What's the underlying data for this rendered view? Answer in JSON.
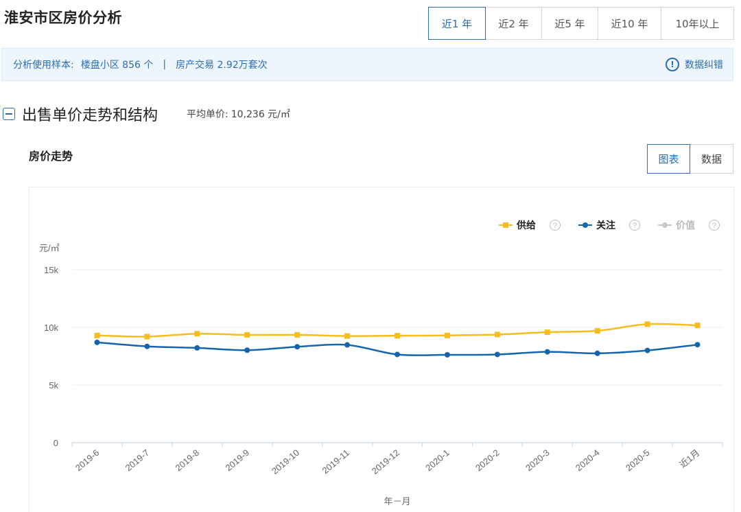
{
  "header": {
    "title": "淮安市区房价分析"
  },
  "range_tabs": [
    {
      "label": "近1 年",
      "active": true
    },
    {
      "label": "近2 年",
      "active": false
    },
    {
      "label": "近5 年",
      "active": false
    },
    {
      "label": "近10 年",
      "active": false
    },
    {
      "label": "10年以上",
      "active": false
    }
  ],
  "info_bar": {
    "sample_prefix": "分析使用样本:",
    "sample_value": "楼盘小区 856 个",
    "separator": "|",
    "trade_value": "房产交易 2.92万套次",
    "correction_label": "数据纠错",
    "correction_icon": "exclamation-circle-icon"
  },
  "section": {
    "title": "出售单价走势和结构",
    "avg_label": "平均单价:",
    "avg_value": "10,236 元/㎡"
  },
  "subsection": {
    "title": "房价走势"
  },
  "view_toggle": {
    "chart_label": "图表",
    "data_label": "数据",
    "active": "chart"
  },
  "colors": {
    "accent": "#2a6db5",
    "supply": "#f7bd1e",
    "attention": "#1565ad",
    "value": "#c8c8c8",
    "grid": "#ececec"
  },
  "chart_data": {
    "type": "line",
    "unit": "元/㎡",
    "xlabel": "年－月",
    "categories": [
      "2019-6",
      "2019-7",
      "2019-8",
      "2019-9",
      "2019-10",
      "2019-11",
      "2019-12",
      "2020-1",
      "2020-2",
      "2020-3",
      "2020-4",
      "2020-5",
      "近1月"
    ],
    "ylim": [
      0,
      15000
    ],
    "yticks": [
      0,
      5000,
      10000,
      15000
    ],
    "ytick_labels": [
      "0",
      "5k",
      "10k",
      "15k"
    ],
    "grid": true,
    "legend_position": "top-right",
    "series": [
      {
        "name": "供给",
        "color": "#f7bd1e",
        "marker": "square",
        "active": true,
        "values": [
          9300,
          9200,
          9450,
          9350,
          9350,
          9250,
          9280,
          9300,
          9380,
          9580,
          9700,
          10280,
          10170
        ]
      },
      {
        "name": "关注",
        "color": "#1565ad",
        "marker": "circle",
        "active": true,
        "values": [
          8700,
          8350,
          8220,
          8020,
          8320,
          8480,
          7650,
          7620,
          7650,
          7880,
          7750,
          8000,
          8500
        ]
      },
      {
        "name": "价值",
        "color": "#c8c8c8",
        "marker": "circle",
        "active": false,
        "values": []
      }
    ],
    "help_icon": "question-circle-icon"
  }
}
